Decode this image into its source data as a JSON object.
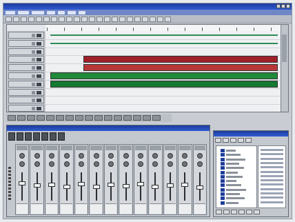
{
  "app": {
    "title": ""
  },
  "menu": {
    "items": [
      "",
      "",
      "",
      "",
      "",
      "",
      ""
    ]
  },
  "arrange": {
    "ruler_ticks": 14,
    "tracks": [
      {
        "name": "",
        "regions": [
          {
            "start": 0.02,
            "end": 0.98,
            "color": "#2e8b57",
            "kind": "line"
          }
        ]
      },
      {
        "name": "",
        "regions": [
          {
            "start": 0.02,
            "end": 0.98,
            "color": "#2e8b57",
            "kind": "line"
          }
        ]
      },
      {
        "name": "",
        "regions": []
      },
      {
        "name": "",
        "regions": [
          {
            "start": 0.16,
            "end": 0.98,
            "color": "#a0202a",
            "kind": "block"
          }
        ]
      },
      {
        "name": "",
        "regions": [
          {
            "start": 0.16,
            "end": 0.98,
            "color": "#b83838",
            "kind": "block"
          }
        ]
      },
      {
        "name": "",
        "regions": [
          {
            "start": 0.02,
            "end": 0.98,
            "color": "#1f8a3a",
            "kind": "block"
          }
        ]
      },
      {
        "name": "",
        "regions": [
          {
            "start": 0.02,
            "end": 0.98,
            "color": "#137a2f",
            "kind": "block"
          }
        ]
      },
      {
        "name": "",
        "regions": []
      },
      {
        "name": "",
        "regions": []
      },
      {
        "name": "",
        "regions": []
      }
    ]
  },
  "mixer": {
    "title": "",
    "channels": [
      {
        "label": "",
        "fader": 0.62
      },
      {
        "label": "",
        "fader": 0.55
      },
      {
        "label": "",
        "fader": 0.58
      },
      {
        "label": "",
        "fader": 0.5
      },
      {
        "label": "",
        "fader": 0.6
      },
      {
        "label": "",
        "fader": 0.48
      },
      {
        "label": "",
        "fader": 0.57
      },
      {
        "label": "",
        "fader": 0.52
      },
      {
        "label": "",
        "fader": 0.6
      },
      {
        "label": "",
        "fader": 0.5
      },
      {
        "label": "",
        "fader": 0.55
      },
      {
        "label": "",
        "fader": 0.58
      },
      {
        "label": "",
        "fader": 0.45
      }
    ]
  },
  "browser": {
    "title": "",
    "tree_items": [
      "",
      "",
      "",
      "",
      "",
      "",
      "",
      "",
      "",
      "",
      "",
      "",
      ""
    ],
    "list_rows": 13
  },
  "colors": {
    "accent": "#2f5bd2",
    "track_green": "#1f8a3a",
    "track_red": "#a0202a"
  }
}
